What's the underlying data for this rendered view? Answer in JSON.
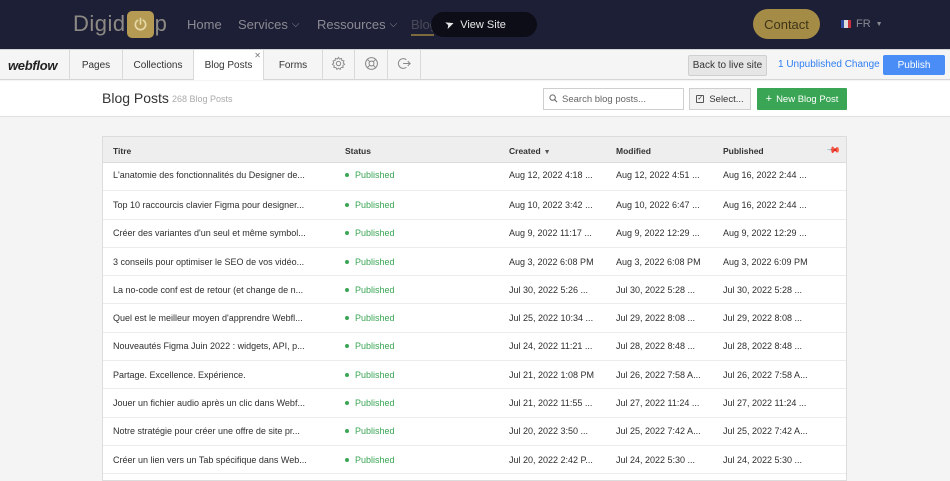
{
  "site": {
    "logo_left": "Digid",
    "logo_right": "p",
    "nav": [
      {
        "label": "Home",
        "has_chevron": false
      },
      {
        "label": "Services",
        "has_chevron": true
      },
      {
        "label": "Ressources",
        "has_chevron": true
      }
    ],
    "nav_blog": "Blog",
    "view_site": "View Site",
    "contact": "Contact",
    "lang": "FR"
  },
  "editor": {
    "brand": "webflow",
    "tabs": [
      {
        "label": "Pages"
      },
      {
        "label": "Collections"
      },
      {
        "label": "Blog Posts",
        "active": true
      },
      {
        "label": "Forms"
      }
    ],
    "icon_tabs": [
      "gear-icon",
      "help-icon",
      "logout-icon"
    ],
    "back_to_live": "Back to live site",
    "unpublished": "1 Unpublished Change",
    "publish": "Publish"
  },
  "toolbar": {
    "title": "Blog Posts",
    "count": "268 Blog Posts",
    "search_placeholder": "Search blog posts...",
    "select_label": "Select...",
    "new_post_label": "New Blog Post"
  },
  "table": {
    "headers": {
      "title": "Titre",
      "status": "Status",
      "created": "Created",
      "modified": "Modified",
      "published": "Published"
    },
    "rows": [
      {
        "title": "L'anatomie des fonctionnalités du Designer de...",
        "status": "Published",
        "created": "Aug 12, 2022 4:18 ...",
        "modified": "Aug 12, 2022 4:51 ...",
        "published": "Aug 16, 2022 2:44 ..."
      },
      {
        "title": "Top 10 raccourcis clavier Figma pour designer...",
        "status": "Published",
        "created": "Aug 10, 2022 3:42 ...",
        "modified": "Aug 10, 2022 6:47 ...",
        "published": "Aug 16, 2022 2:44 ..."
      },
      {
        "title": "Créer des variantes d'un seul et même symbol...",
        "status": "Published",
        "created": "Aug 9, 2022 11:17 ...",
        "modified": "Aug 9, 2022 12:29 ...",
        "published": "Aug 9, 2022 12:29 ..."
      },
      {
        "title": "3 conseils pour optimiser le SEO de vos vidéo...",
        "status": "Published",
        "created": "Aug 3, 2022 6:08 PM",
        "modified": "Aug 3, 2022 6:08 PM",
        "published": "Aug 3, 2022 6:09 PM"
      },
      {
        "title": "La no-code conf est de retour (et change de n...",
        "status": "Published",
        "created": "Jul 30, 2022 5:26 ...",
        "modified": "Jul 30, 2022 5:28 ...",
        "published": "Jul 30, 2022 5:28 ..."
      },
      {
        "title": "Quel est le meilleur moyen d'apprendre Webfl...",
        "status": "Published",
        "created": "Jul 25, 2022 10:34 ...",
        "modified": "Jul 29, 2022 8:08 ...",
        "published": "Jul 29, 2022 8:08 ..."
      },
      {
        "title": "Nouveautés Figma Juin 2022 : widgets, API, p...",
        "status": "Published",
        "created": "Jul 24, 2022 11:21 ...",
        "modified": "Jul 28, 2022 8:48 ...",
        "published": "Jul 28, 2022 8:48 ..."
      },
      {
        "title": "Partage. Excellence. Expérience.",
        "status": "Published",
        "created": "Jul 21, 2022 1:08 PM",
        "modified": "Jul 26, 2022 7:58 A...",
        "published": "Jul 26, 2022 7:58 A..."
      },
      {
        "title": "Jouer un fichier audio après un clic dans Webf...",
        "status": "Published",
        "created": "Jul 21, 2022 11:55 ...",
        "modified": "Jul 27, 2022 11:24 ...",
        "published": "Jul 27, 2022 11:24 ..."
      },
      {
        "title": "Notre stratégie pour créer une offre de site pr...",
        "status": "Published",
        "created": "Jul 20, 2022 3:50 ...",
        "modified": "Jul 25, 2022 7:42 A...",
        "published": "Jul 25, 2022 7:42 A..."
      },
      {
        "title": "Créer un lien vers un Tab spécifique dans Web...",
        "status": "Published",
        "created": "Jul 20, 2022 2:42 P...",
        "modified": "Jul 24, 2022 5:30 ...",
        "published": "Jul 24, 2022 5:30 ..."
      }
    ]
  },
  "colors": {
    "header_bg": "#1d1f36",
    "gold": "#a48c47",
    "publish_blue": "#4a8df6",
    "green": "#3aa655"
  }
}
